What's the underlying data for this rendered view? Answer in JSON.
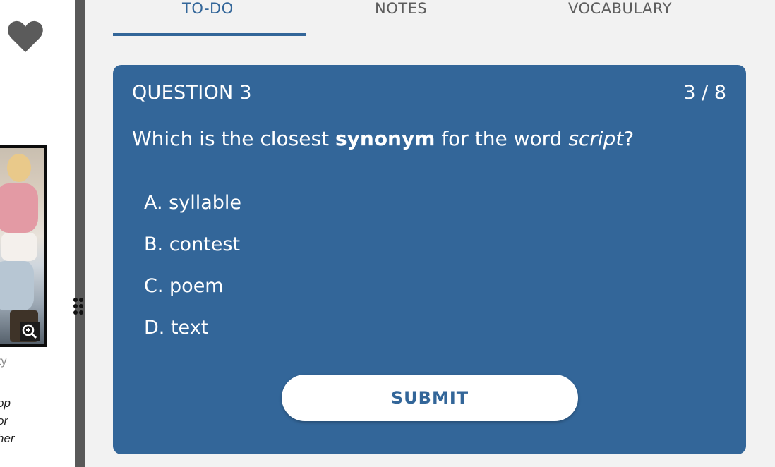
{
  "reader": {
    "caption_credit": "ty",
    "caption_lines": [
      "op",
      "or",
      "her"
    ],
    "heart_icon": "heart-icon",
    "zoom_icon": "magnifier-plus-icon"
  },
  "tabs": [
    {
      "label": "TO-DO",
      "active": true
    },
    {
      "label": "NOTES",
      "active": false
    },
    {
      "label": "VOCABULARY",
      "active": false
    }
  ],
  "question": {
    "title": "QUESTION 3",
    "counter": "3 / 8",
    "prompt_pre": "Which is the closest ",
    "prompt_bold": "synonym",
    "prompt_mid": " for the word ",
    "prompt_italic": "script",
    "prompt_post": "?",
    "options": [
      {
        "letter": "A.",
        "text": "syllable"
      },
      {
        "letter": "B.",
        "text": "contest"
      },
      {
        "letter": "C.",
        "text": "poem"
      },
      {
        "letter": "D.",
        "text": "text"
      }
    ],
    "submit_label": "SUBMIT"
  },
  "colors": {
    "accent": "#336699",
    "panel_bg": "#f2f2f2",
    "splitter": "#595959"
  }
}
